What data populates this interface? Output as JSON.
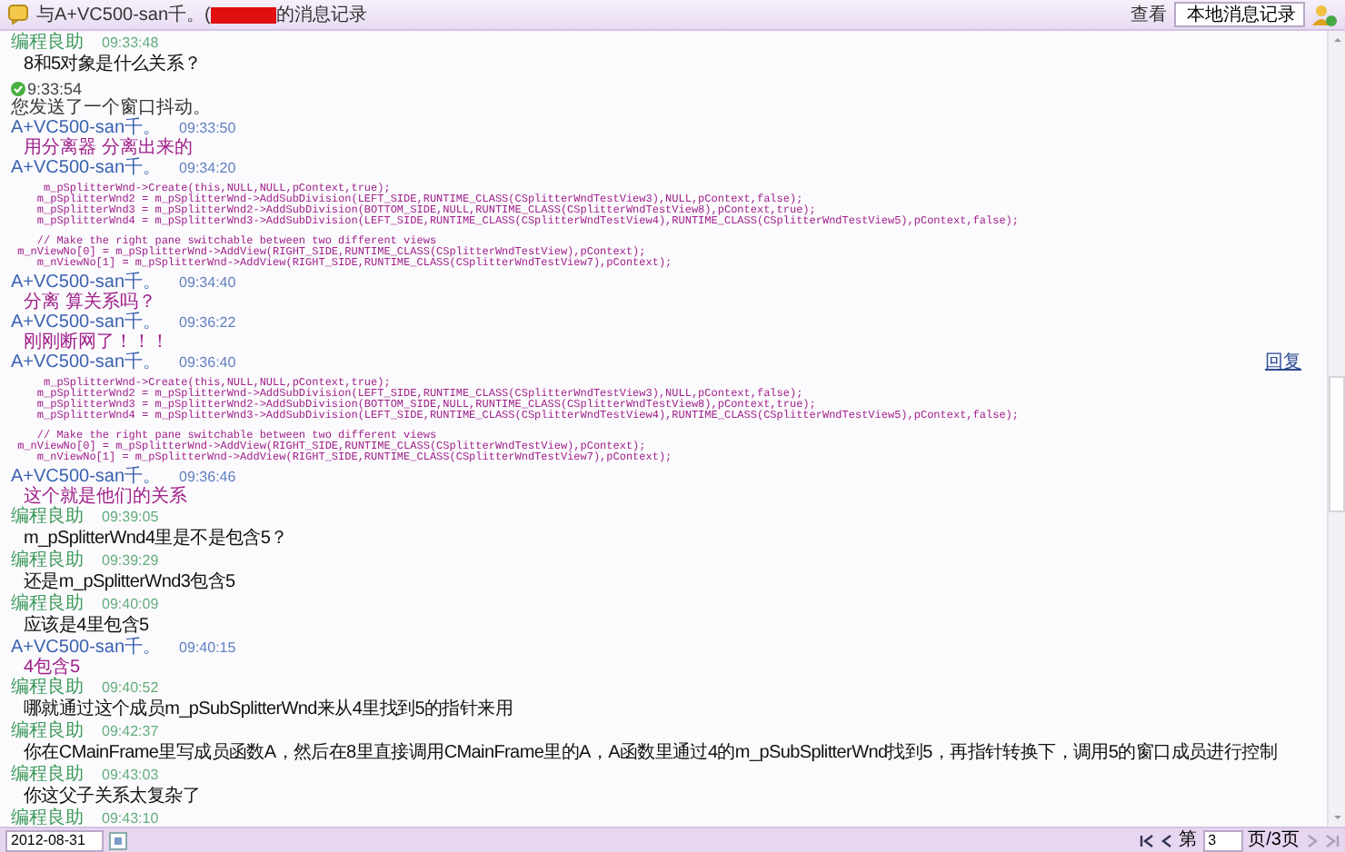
{
  "window": {
    "title_prefix": "与A+VC500-san千。(",
    "title_suffix": "的消息记录"
  },
  "toolbar": {
    "view_label": "查看",
    "source": "本地消息记录"
  },
  "messages": [
    {
      "kind": "header",
      "sender": "编程良助",
      "time": "09:33:48",
      "color": "#3c9a5a"
    },
    {
      "kind": "message",
      "text": "8和5对象是什么关系？"
    },
    {
      "kind": "system",
      "time": "9:33:54",
      "text": "您发送了一个窗口抖动。"
    },
    {
      "kind": "header",
      "sender": "A+VC500-san千。",
      "time": "09:33:50",
      "color": "#3a62b0"
    },
    {
      "kind": "note",
      "text": "用分离器 分离出来的"
    },
    {
      "kind": "header",
      "sender": "A+VC500-san千。",
      "time": "09:34:20",
      "color": "#3a62b0"
    },
    {
      "kind": "code",
      "paragraphs": [
        [
          "     m_pSplitterWnd->Create(this,NULL,NULL,pContext,true);",
          "    m_pSplitterWnd2 = m_pSplitterWnd->AddSubDivision(LEFT_SIDE,RUNTIME_CLASS(CSplitterWndTestView3),NULL,pContext,false);",
          "    m_pSplitterWnd3 = m_pSplitterWnd2->AddSubDivision(BOTTOM_SIDE,NULL,RUNTIME_CLASS(CSplitterWndTestView8),pContext,true);",
          "    m_pSplitterWnd4 = m_pSplitterWnd3->AddSubDivision(LEFT_SIDE,RUNTIME_CLASS(CSplitterWndTestView4),RUNTIME_CLASS(CSplitterWndTestView5),pContext,false);"
        ],
        [
          "    // Make the right pane switchable between two different views",
          " m_nViewNo[0] = m_pSplitterWnd->AddView(RIGHT_SIDE,RUNTIME_CLASS(CSplitterWndTestView),pContext);",
          "    m_nViewNo[1] = m_pSplitterWnd->AddView(RIGHT_SIDE,RUNTIME_CLASS(CSplitterWndTestView7),pContext);"
        ]
      ]
    },
    {
      "kind": "header",
      "sender": "A+VC500-san千。",
      "time": "09:34:40",
      "color": "#3a62b0"
    },
    {
      "kind": "note",
      "text": "分离 算关系吗？"
    },
    {
      "kind": "header",
      "sender": "A+VC500-san千。",
      "time": "09:36:22",
      "color": "#3a62b0"
    },
    {
      "kind": "note",
      "text": "刚刚断网了！！！"
    },
    {
      "kind": "header",
      "sender": "A+VC500-san千。",
      "time": "09:36:40",
      "color": "#3a62b0",
      "reply": "回复"
    },
    {
      "kind": "code",
      "paragraphs": [
        [
          "     m_pSplitterWnd->Create(this,NULL,NULL,pContext,true);",
          "    m_pSplitterWnd2 = m_pSplitterWnd->AddSubDivision(LEFT_SIDE,RUNTIME_CLASS(CSplitterWndTestView3),NULL,pContext,false);",
          "    m_pSplitterWnd3 = m_pSplitterWnd2->AddSubDivision(BOTTOM_SIDE,NULL,RUNTIME_CLASS(CSplitterWndTestView8),pContext,true);",
          "    m_pSplitterWnd4 = m_pSplitterWnd3->AddSubDivision(LEFT_SIDE,RUNTIME_CLASS(CSplitterWndTestView4),RUNTIME_CLASS(CSplitterWndTestView5),pContext,false);"
        ],
        [
          "    // Make the right pane switchable between two different views",
          " m_nViewNo[0] = m_pSplitterWnd->AddView(RIGHT_SIDE,RUNTIME_CLASS(CSplitterWndTestView),pContext);",
          "    m_nViewNo[1] = m_pSplitterWnd->AddView(RIGHT_SIDE,RUNTIME_CLASS(CSplitterWndTestView7),pContext);"
        ]
      ]
    },
    {
      "kind": "header",
      "sender": "A+VC500-san千。",
      "time": "09:36:46",
      "color": "#3a62b0"
    },
    {
      "kind": "note",
      "text": "这个就是他们的关系"
    },
    {
      "kind": "header",
      "sender": "编程良助",
      "time": "09:39:05",
      "color": "#3c9a5a"
    },
    {
      "kind": "message",
      "text": "m_pSplitterWnd4里是不是包含5？"
    },
    {
      "kind": "header",
      "sender": "编程良助",
      "time": "09:39:29",
      "color": "#3c9a5a"
    },
    {
      "kind": "message",
      "text": "还是m_pSplitterWnd3包含5"
    },
    {
      "kind": "header",
      "sender": "编程良助",
      "time": "09:40:09",
      "color": "#3c9a5a"
    },
    {
      "kind": "message",
      "text": "应该是4里包含5"
    },
    {
      "kind": "header",
      "sender": "A+VC500-san千。",
      "time": "09:40:15",
      "color": "#3a62b0"
    },
    {
      "kind": "note",
      "text": "4包含5"
    },
    {
      "kind": "header",
      "sender": "编程良助",
      "time": "09:40:52",
      "color": "#3c9a5a"
    },
    {
      "kind": "message",
      "text": "哪就通过这个成员m_pSubSplitterWnd来从4里找到5的指针来用"
    },
    {
      "kind": "header",
      "sender": "编程良助",
      "time": "09:42:37",
      "color": "#3c9a5a"
    },
    {
      "kind": "message",
      "text": "你在CMainFrame里写成员函数A，然后在8里直接调用CMainFrame里的A，A函数里通过4的m_pSubSplitterWnd找到5，再指针转换下，调用5的窗口成员进行控制"
    },
    {
      "kind": "header",
      "sender": "编程良助",
      "time": "09:43:03",
      "color": "#3c9a5a"
    },
    {
      "kind": "message",
      "text": "你这父子关系太复杂了"
    },
    {
      "kind": "header",
      "sender": "编程良助",
      "time": "09:43:10",
      "color": "#3c9a5a"
    }
  ],
  "footer": {
    "date": "2012-08-31",
    "page_prefix": "第",
    "page": "3",
    "page_suffix": "页/3页",
    "first_disabled": false,
    "prev_disabled": false,
    "next_disabled": true,
    "last_disabled": true
  }
}
